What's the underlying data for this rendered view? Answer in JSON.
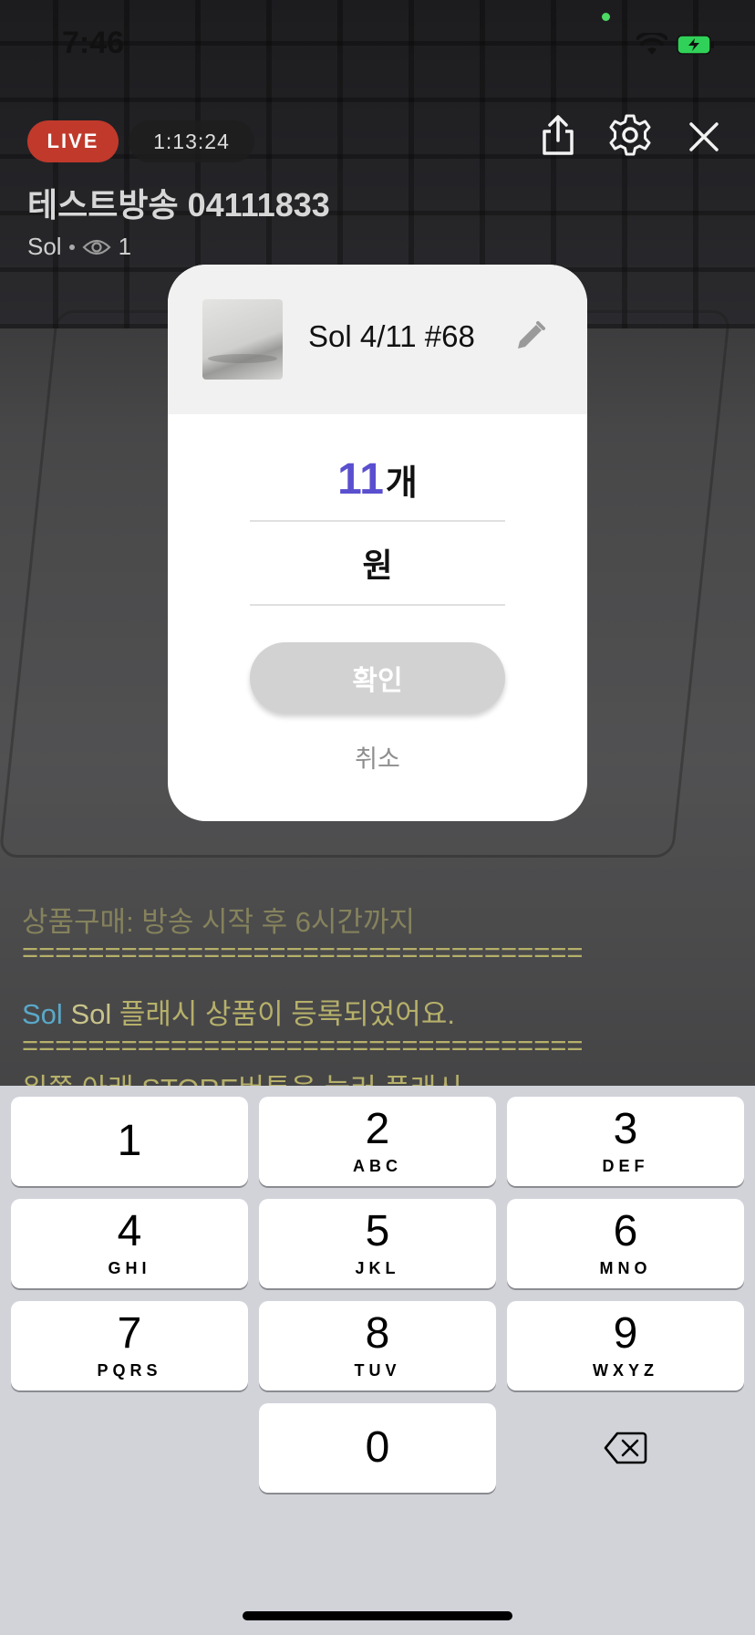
{
  "status_bar": {
    "time": "7:46"
  },
  "live": {
    "badge": "LIVE",
    "elapsed": "1:13:24",
    "title": "테스트방송 04111833",
    "host": "Sol",
    "viewers": "1"
  },
  "chat": {
    "line1": "상품구매: 방송 시작 후 6시간까지",
    "sep1": "==================================",
    "line2_name": "Sol",
    "line2_name2": "Sol",
    "line2_text": "플래시 상품이 등록되었어요.",
    "sep2": "==================================",
    "line3": "왼쪽 아래 STORE버튼을 눌러 플래시"
  },
  "modal": {
    "product_name": "Sol 4/11 #68",
    "quantity_value": "11",
    "quantity_unit": "개",
    "price_unit": "원",
    "confirm_label": "확인",
    "cancel_label": "취소"
  },
  "keypad": {
    "keys": [
      {
        "num": "1",
        "letters": ""
      },
      {
        "num": "2",
        "letters": "ABC"
      },
      {
        "num": "3",
        "letters": "DEF"
      },
      {
        "num": "4",
        "letters": "GHI"
      },
      {
        "num": "5",
        "letters": "JKL"
      },
      {
        "num": "6",
        "letters": "MNO"
      },
      {
        "num": "7",
        "letters": "PQRS"
      },
      {
        "num": "8",
        "letters": "TUV"
      },
      {
        "num": "9",
        "letters": "WXYZ"
      },
      {
        "num": "0",
        "letters": ""
      }
    ]
  },
  "colors": {
    "accent": "#5a4fcf",
    "live_red": "#c0392b",
    "chat_name": "#5aa8c8",
    "chat_text": "#b6b06a"
  }
}
